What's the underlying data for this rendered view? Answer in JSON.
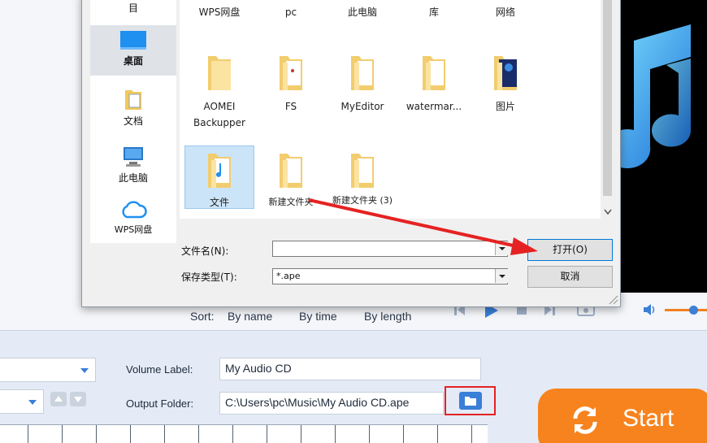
{
  "dialog": {
    "nav": [
      {
        "label": "目",
        "icon": "folder-icon"
      },
      {
        "label": "桌面",
        "icon": "desktop-icon"
      },
      {
        "label": "文档",
        "icon": "documents-icon"
      },
      {
        "label": "此电脑",
        "icon": "computer-icon"
      },
      {
        "label": "WPS网盘",
        "icon": "cloud-icon"
      }
    ],
    "files": [
      {
        "label": "WPS网盘"
      },
      {
        "label": "pc"
      },
      {
        "label": "此电脑"
      },
      {
        "label": "库"
      },
      {
        "label": "网络"
      },
      {
        "label": "AOMEI Backupper"
      },
      {
        "label": "FS"
      },
      {
        "label": "MyEditor"
      },
      {
        "label": "watermar..."
      },
      {
        "label": "图片"
      },
      {
        "label": "文件"
      },
      {
        "label": "新建文件夹"
      },
      {
        "label": "新建文件夹 (3)"
      }
    ],
    "selected_file": "文件",
    "filename_label": "文件名(N):",
    "filename_value": "",
    "filetype_label": "保存类型(T):",
    "filetype_value": "*.ape",
    "open_button": "打开(O)",
    "cancel_button": "取消"
  },
  "sort": {
    "label": "Sort:",
    "options": [
      "By name",
      "By time",
      "By length"
    ]
  },
  "bottom": {
    "volume_label_caption": "Volume Label:",
    "volume_label_value": "My Audio CD",
    "output_folder_caption": "Output Folder:",
    "output_folder_value": "C:\\Users\\pc\\Music\\My Audio CD.ape",
    "start_label": "Start"
  },
  "colors": {
    "accent_blue": "#3a7fd8",
    "start_orange": "#f7831e",
    "highlight_red": "#e52222"
  }
}
